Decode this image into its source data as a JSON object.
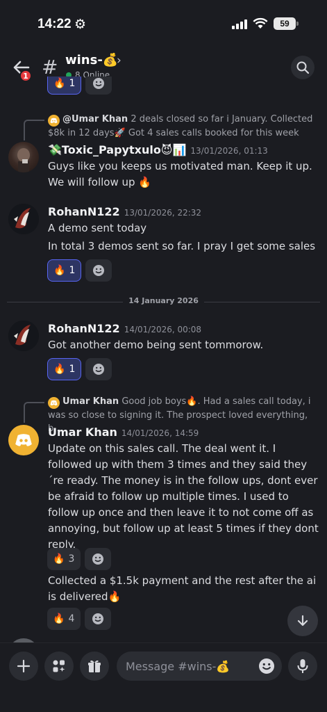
{
  "status_bar": {
    "time": "14:22",
    "battery": "59"
  },
  "header": {
    "back_badge": "1",
    "channel_name": "wins-💰",
    "online_text": "8 Online"
  },
  "messages": [
    {
      "reply": {
        "author": "@Umar Khan",
        "text": "2 deals closed so far i January. Collected $8k in 12 days🚀 Got 4 sales calls booked for this week"
      },
      "author": "💸Toxic_Papytxulo😈📊",
      "timestamp": "13/01/2026, 01:13",
      "text": "Guys like you keeps us motivated man. Keep it up. We will follow up 🔥"
    },
    {
      "author": "RohanN122",
      "timestamp": "13/01/2026, 22:32",
      "lines": [
        "A demo sent today",
        "In total 3 demos sent so far. I pray I get some sales"
      ],
      "reaction": {
        "emoji": "🔥",
        "count": "1"
      }
    },
    {
      "author": "RohanN122",
      "timestamp": "14/01/2026, 00:08",
      "text": "Got another  demo being sent tommorow.",
      "reaction": {
        "emoji": "🔥",
        "count": "1"
      }
    },
    {
      "reply": {
        "author": "Umar Khan",
        "text": "Good job boys🔥. Had a sales call today, i was so close to signing it. The prospect loved everything, b..."
      },
      "author": "Umar Khan",
      "timestamp": "14/01/2026, 14:59",
      "text": "Update on this sales call. The deal went it. I followed up with them 3 times and they said they´re ready. The money is in the follow ups, dont ever be afraid to follow up multiple times. I used to follow up once and then leave it to not come off as annoying, but follow up at least 5 times if they dont reply.",
      "reaction": {
        "emoji": "🔥",
        "count": "3"
      },
      "followup_text": "Collected a $1.5k payment and the rest after the ai is delivered🔥",
      "followup_reaction": {
        "emoji": "🔥",
        "count": "4"
      }
    }
  ],
  "top_reaction": {
    "emoji": "🔥",
    "count": "1"
  },
  "date_divider": "14 January 2026",
  "composer": {
    "placeholder": "Message #wins-💰"
  },
  "colors": {
    "background": "#1b1c21",
    "accent": "#5865f2",
    "discord_yellow": "#f0b232",
    "badge_red": "#e5393d",
    "online_green": "#23a55a"
  }
}
